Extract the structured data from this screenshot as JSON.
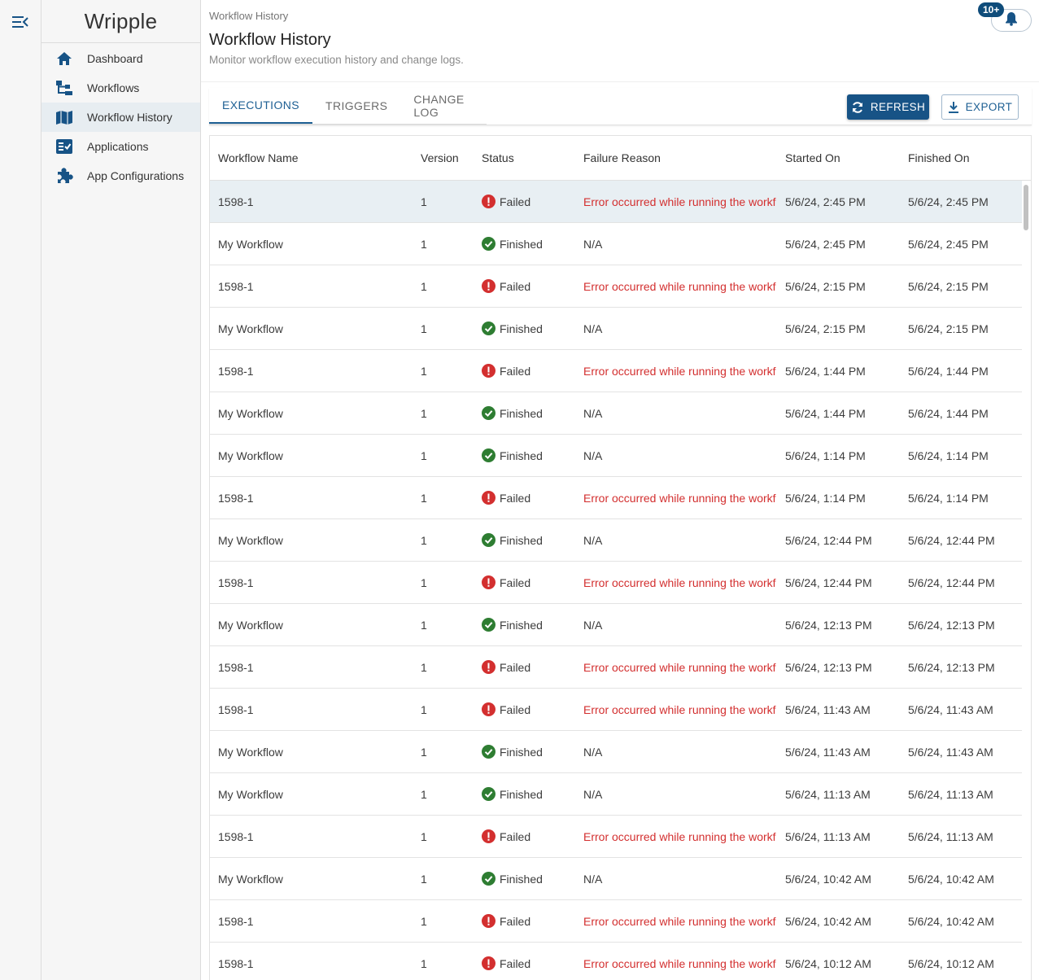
{
  "app": {
    "brand": "Wripple"
  },
  "sidebar": {
    "items": [
      {
        "label": "Dashboard",
        "icon": "home-icon"
      },
      {
        "label": "Workflows",
        "icon": "workflow-tree-icon"
      },
      {
        "label": "Workflow History",
        "icon": "map-book-icon",
        "active": true
      },
      {
        "label": "Applications",
        "icon": "checklist-icon"
      },
      {
        "label": "App Configurations",
        "icon": "puzzle-icon"
      }
    ]
  },
  "header": {
    "breadcrumb": "Workflow History",
    "title": "Workflow History",
    "subtitle": "Monitor workflow execution history and change logs.",
    "notifications_badge": "10+"
  },
  "tabs": [
    {
      "label": "EXECUTIONS",
      "active": true
    },
    {
      "label": "TRIGGERS",
      "active": false
    },
    {
      "label": "CHANGE LOG",
      "active": false
    }
  ],
  "toolbar": {
    "refresh_label": "REFRESH",
    "export_label": "EXPORT"
  },
  "colors": {
    "primary": "#175386",
    "failed": "#d32f2f",
    "finished": "#2e7d32",
    "selected_row": "#e8eff3"
  },
  "table": {
    "columns": [
      "Workflow Name",
      "Version",
      "Status",
      "Failure Reason",
      "Started On",
      "Finished On"
    ],
    "rows": [
      {
        "name": "1598-1",
        "version": "1",
        "status": "Failed",
        "reason": "Error occurred while running the workf",
        "started": "5/6/24, 2:45 PM",
        "finished": "5/6/24, 2:45 PM",
        "selected": true
      },
      {
        "name": "My Workflow",
        "version": "1",
        "status": "Finished",
        "reason": "N/A",
        "started": "5/6/24, 2:45 PM",
        "finished": "5/6/24, 2:45 PM"
      },
      {
        "name": "1598-1",
        "version": "1",
        "status": "Failed",
        "reason": "Error occurred while running the workf",
        "started": "5/6/24, 2:15 PM",
        "finished": "5/6/24, 2:15 PM"
      },
      {
        "name": "My Workflow",
        "version": "1",
        "status": "Finished",
        "reason": "N/A",
        "started": "5/6/24, 2:15 PM",
        "finished": "5/6/24, 2:15 PM"
      },
      {
        "name": "1598-1",
        "version": "1",
        "status": "Failed",
        "reason": "Error occurred while running the workf",
        "started": "5/6/24, 1:44 PM",
        "finished": "5/6/24, 1:44 PM"
      },
      {
        "name": "My Workflow",
        "version": "1",
        "status": "Finished",
        "reason": "N/A",
        "started": "5/6/24, 1:44 PM",
        "finished": "5/6/24, 1:44 PM"
      },
      {
        "name": "My Workflow",
        "version": "1",
        "status": "Finished",
        "reason": "N/A",
        "started": "5/6/24, 1:14 PM",
        "finished": "5/6/24, 1:14 PM"
      },
      {
        "name": "1598-1",
        "version": "1",
        "status": "Failed",
        "reason": "Error occurred while running the workf",
        "started": "5/6/24, 1:14 PM",
        "finished": "5/6/24, 1:14 PM"
      },
      {
        "name": "My Workflow",
        "version": "1",
        "status": "Finished",
        "reason": "N/A",
        "started": "5/6/24, 12:44 PM",
        "finished": "5/6/24, 12:44 PM"
      },
      {
        "name": "1598-1",
        "version": "1",
        "status": "Failed",
        "reason": "Error occurred while running the workf",
        "started": "5/6/24, 12:44 PM",
        "finished": "5/6/24, 12:44 PM"
      },
      {
        "name": "My Workflow",
        "version": "1",
        "status": "Finished",
        "reason": "N/A",
        "started": "5/6/24, 12:13 PM",
        "finished": "5/6/24, 12:13 PM"
      },
      {
        "name": "1598-1",
        "version": "1",
        "status": "Failed",
        "reason": "Error occurred while running the workf",
        "started": "5/6/24, 12:13 PM",
        "finished": "5/6/24, 12:13 PM"
      },
      {
        "name": "1598-1",
        "version": "1",
        "status": "Failed",
        "reason": "Error occurred while running the workf",
        "started": "5/6/24, 11:43 AM",
        "finished": "5/6/24, 11:43 AM"
      },
      {
        "name": "My Workflow",
        "version": "1",
        "status": "Finished",
        "reason": "N/A",
        "started": "5/6/24, 11:43 AM",
        "finished": "5/6/24, 11:43 AM"
      },
      {
        "name": "My Workflow",
        "version": "1",
        "status": "Finished",
        "reason": "N/A",
        "started": "5/6/24, 11:13 AM",
        "finished": "5/6/24, 11:13 AM"
      },
      {
        "name": "1598-1",
        "version": "1",
        "status": "Failed",
        "reason": "Error occurred while running the workf",
        "started": "5/6/24, 11:13 AM",
        "finished": "5/6/24, 11:13 AM"
      },
      {
        "name": "My Workflow",
        "version": "1",
        "status": "Finished",
        "reason": "N/A",
        "started": "5/6/24, 10:42 AM",
        "finished": "5/6/24, 10:42 AM"
      },
      {
        "name": "1598-1",
        "version": "1",
        "status": "Failed",
        "reason": "Error occurred while running the workf",
        "started": "5/6/24, 10:42 AM",
        "finished": "5/6/24, 10:42 AM"
      },
      {
        "name": "1598-1",
        "version": "1",
        "status": "Failed",
        "reason": "Error occurred while running the workf",
        "started": "5/6/24, 10:12 AM",
        "finished": "5/6/24, 10:12 AM"
      }
    ]
  }
}
